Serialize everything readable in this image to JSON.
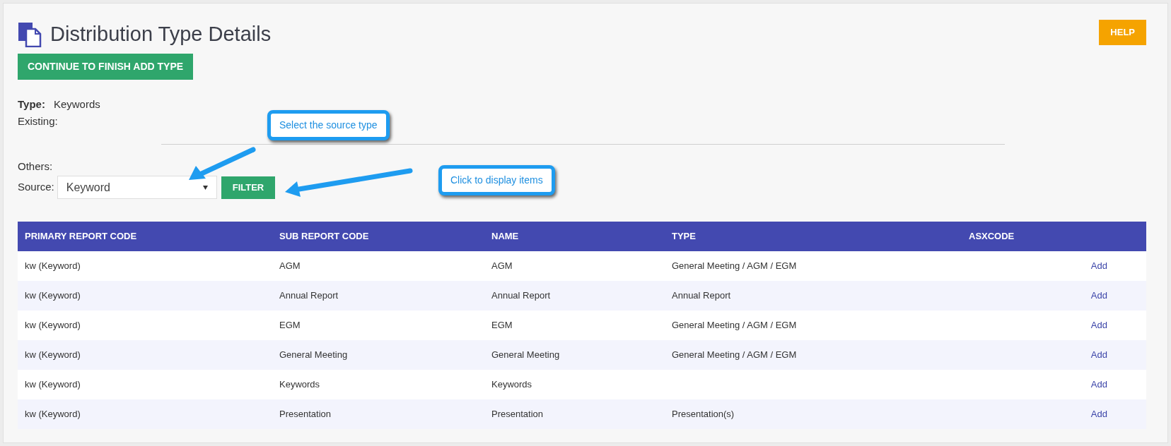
{
  "page": {
    "title": "Distribution Type Details",
    "help_button": "HELP",
    "continue_button": "CONTINUE TO FINISH ADD TYPE"
  },
  "details": {
    "type_label": "Type:",
    "type_value": "Keywords",
    "existing_label": "Existing:",
    "others_label": "Others:"
  },
  "filter": {
    "source_label": "Source:",
    "source_value": "Keyword",
    "filter_button": "FILTER"
  },
  "callouts": [
    "Select the source type",
    "Click to display items"
  ],
  "table": {
    "columns": [
      "PRIMARY REPORT CODE",
      "SUB REPORT CODE",
      "NAME",
      "TYPE",
      "ASXCODE"
    ],
    "rows": [
      {
        "cells": [
          "kw (Keyword)",
          "AGM",
          "AGM",
          "General Meeting / AGM / EGM",
          ""
        ],
        "action": "Add"
      },
      {
        "cells": [
          "kw (Keyword)",
          "Annual Report",
          "Annual Report",
          "Annual Report",
          ""
        ],
        "action": "Add"
      },
      {
        "cells": [
          "kw (Keyword)",
          "EGM",
          "EGM",
          "General Meeting / AGM / EGM",
          ""
        ],
        "action": "Add"
      },
      {
        "cells": [
          "kw (Keyword)",
          "General Meeting",
          "General Meeting",
          "General Meeting / AGM / EGM",
          ""
        ],
        "action": "Add"
      },
      {
        "cells": [
          "kw (Keyword)",
          "Keywords",
          "Keywords",
          "",
          ""
        ],
        "action": "Add"
      },
      {
        "cells": [
          "kw (Keyword)",
          "Presentation",
          "Presentation",
          "Presentation(s)",
          ""
        ],
        "action": "Add"
      }
    ]
  }
}
